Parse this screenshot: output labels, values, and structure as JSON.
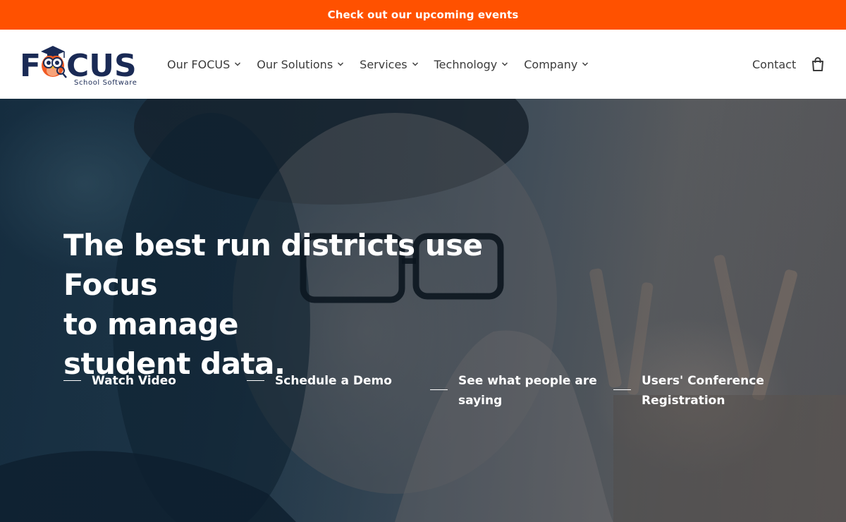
{
  "announcement": {
    "text": "Check out our upcoming events"
  },
  "header": {
    "logo": {
      "wordmark": "FOCUS",
      "tagline": "School Software"
    },
    "nav": [
      {
        "label": "Our FOCUS"
      },
      {
        "label": "Our Solutions"
      },
      {
        "label": "Services"
      },
      {
        "label": "Technology"
      },
      {
        "label": "Company"
      }
    ],
    "contact_label": "Contact",
    "cart_icon": "shopping-bag-icon"
  },
  "hero": {
    "heading_line1": "The best run districts use Focus",
    "heading_line2": "to manage",
    "heading_line3": "student data.",
    "ctas": [
      {
        "label": "Watch Video"
      },
      {
        "label": "Schedule a Demo"
      },
      {
        "label": "See what people are saying"
      },
      {
        "label": "Users' Conference Registration"
      }
    ]
  },
  "colors": {
    "announcement_bg": "#ff5100",
    "logo_navy": "#1a2a55",
    "logo_orange": "#f15a24",
    "nav_text": "#3b3b3b",
    "hero_text": "#ffffff"
  }
}
